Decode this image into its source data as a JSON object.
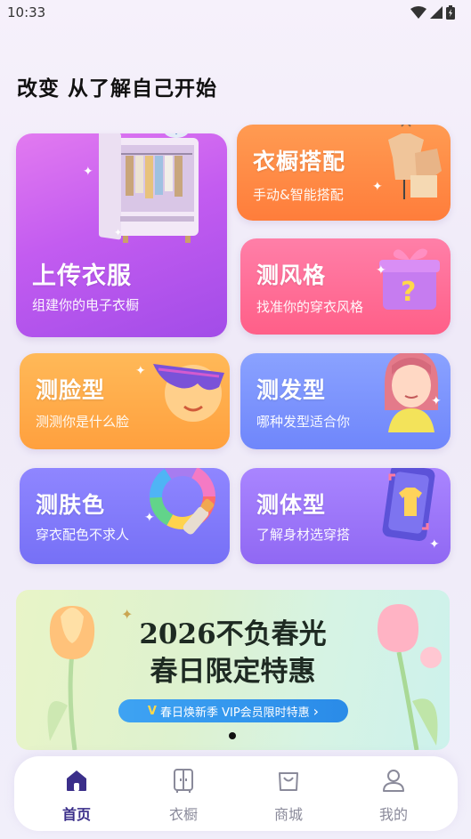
{
  "status_bar": {
    "time": "10:33"
  },
  "headline": "改变 从了解自己开始",
  "cards": {
    "upload": {
      "title": "上传衣服",
      "subtitle": "组建你的电子衣橱"
    },
    "wardrobe_match": {
      "title": "衣橱搭配",
      "subtitle": "手动&智能搭配"
    },
    "style": {
      "title": "测风格",
      "subtitle": "找准你的穿衣风格"
    },
    "face": {
      "title": "测脸型",
      "subtitle": "测测你是什么脸"
    },
    "hair": {
      "title": "测发型",
      "subtitle": "哪种发型适合你"
    },
    "skin": {
      "title": "测肤色",
      "subtitle": "穿衣配色不求人"
    },
    "body": {
      "title": "测体型",
      "subtitle": "了解身材选穿搭"
    }
  },
  "banner": {
    "line1": "2026不负春光",
    "line2": "春日限定特惠",
    "pill_text": "春日焕新季 VIP会员限时特惠",
    "pill_badge": "V",
    "pill_arrow": "›"
  },
  "tabbar": {
    "items": [
      {
        "label": "首页",
        "icon": "home-icon",
        "active": true
      },
      {
        "label": "衣橱",
        "icon": "wardrobe-icon",
        "active": false
      },
      {
        "label": "商城",
        "icon": "shop-bag-icon",
        "active": false
      },
      {
        "label": "我的",
        "icon": "profile-icon",
        "active": false
      }
    ]
  },
  "colors": {
    "upload": "#b658f0",
    "wardrobe_match": "#ff7a3d",
    "style": "#ff5f88",
    "face": "#ffa344",
    "hair": "#6f8cff",
    "skin": "#7b76f7",
    "body": "#9a6cf5",
    "tab_active": "#3b2f8a"
  }
}
